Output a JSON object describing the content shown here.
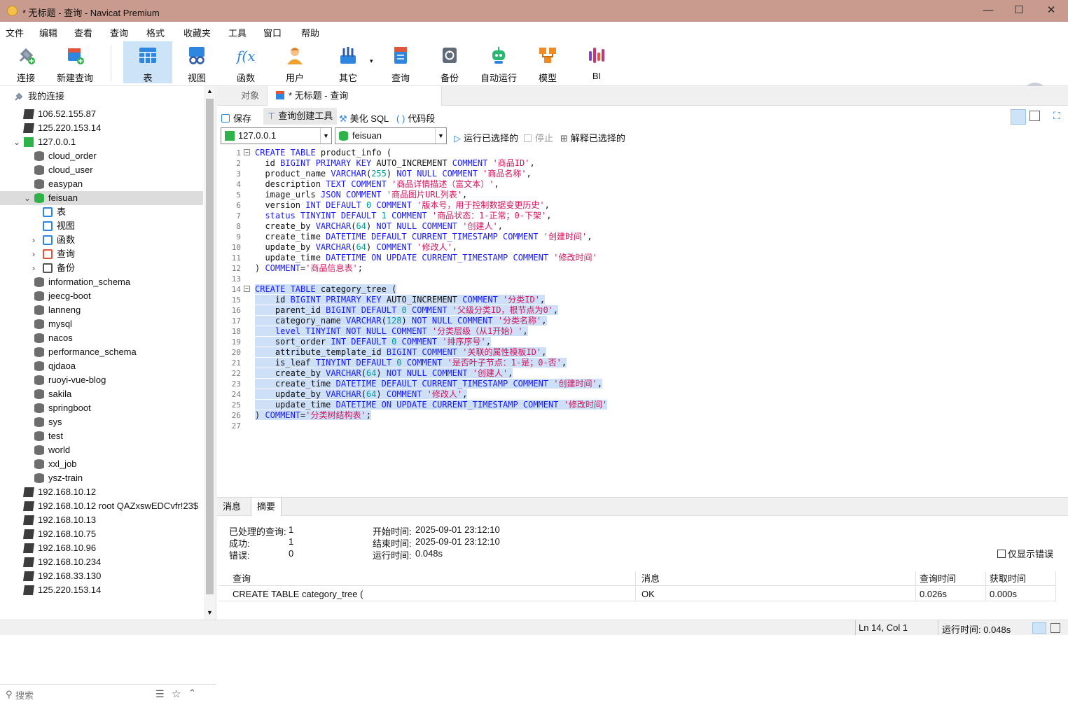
{
  "window": {
    "title": "* 无标题 - 查询 - Navicat Premium",
    "min": "—",
    "max": "☐",
    "close": "✕"
  },
  "menu": [
    "文件",
    "编辑",
    "查看",
    "查询",
    "格式",
    "收藏夹",
    "工具",
    "窗口",
    "帮助"
  ],
  "toolbar": [
    {
      "label": "连接",
      "icon": "plug-icon",
      "color": "#7a8a9a"
    },
    {
      "label": "新建查询",
      "icon": "new-query-icon",
      "color": "#e0563b"
    },
    {
      "label": "表",
      "icon": "table-icon",
      "color": "#2e86de"
    },
    {
      "label": "视图",
      "icon": "view-icon",
      "color": "#2e86de"
    },
    {
      "label": "函数",
      "icon": "function-icon",
      "color": "#2e86de"
    },
    {
      "label": "用户",
      "icon": "user-icon",
      "color": "#f0a030"
    },
    {
      "label": "其它",
      "icon": "tools-icon",
      "color": "#2e86de"
    },
    {
      "label": "查询",
      "icon": "query-icon",
      "color": "#e0563b"
    },
    {
      "label": "备份",
      "icon": "backup-icon",
      "color": "#666666"
    },
    {
      "label": "自动运行",
      "icon": "robot-icon",
      "color": "#2bb673"
    },
    {
      "label": "模型",
      "icon": "model-icon",
      "color": "#f08a24"
    },
    {
      "label": "BI",
      "icon": "bi-icon",
      "color": "#c0397a"
    }
  ],
  "sidebar": {
    "header": "我的连接",
    "items": [
      {
        "label": "106.52.155.87",
        "type": "conn",
        "indent": 0
      },
      {
        "label": "125.220.153.14",
        "type": "conn",
        "indent": 0
      },
      {
        "label": "127.0.0.1",
        "type": "conng",
        "indent": 0,
        "arrow": "⌄"
      },
      {
        "label": "cloud_order",
        "type": "db",
        "indent": 1
      },
      {
        "label": "cloud_user",
        "type": "db",
        "indent": 1
      },
      {
        "label": "easypan",
        "type": "db",
        "indent": 1
      },
      {
        "label": "feisuan",
        "type": "dbg",
        "indent": 1,
        "arrow": "⌄"
      },
      {
        "label": "表",
        "type": "obj",
        "indent": 2
      },
      {
        "label": "视图",
        "type": "obj",
        "indent": 2
      },
      {
        "label": "函数",
        "type": "obj",
        "indent": 2,
        "arrow": "›"
      },
      {
        "label": "查询",
        "type": "obj",
        "indent": 2,
        "arrow": "›"
      },
      {
        "label": "备份",
        "type": "obj",
        "indent": 2,
        "arrow": "›"
      },
      {
        "label": "information_schema",
        "type": "db",
        "indent": 1
      },
      {
        "label": "jeecg-boot",
        "type": "db",
        "indent": 1
      },
      {
        "label": "lanneng",
        "type": "db",
        "indent": 1
      },
      {
        "label": "mysql",
        "type": "db",
        "indent": 1
      },
      {
        "label": "nacos",
        "type": "db",
        "indent": 1
      },
      {
        "label": "performance_schema",
        "type": "db",
        "indent": 1
      },
      {
        "label": "qjdaoa",
        "type": "db",
        "indent": 1
      },
      {
        "label": "ruoyi-vue-blog",
        "type": "db",
        "indent": 1
      },
      {
        "label": "sakila",
        "type": "db",
        "indent": 1
      },
      {
        "label": "springboot",
        "type": "db",
        "indent": 1
      },
      {
        "label": "sys",
        "type": "db",
        "indent": 1
      },
      {
        "label": "test",
        "type": "db",
        "indent": 1
      },
      {
        "label": "world",
        "type": "db",
        "indent": 1
      },
      {
        "label": "xxl_job",
        "type": "db",
        "indent": 1
      },
      {
        "label": "ysz-train",
        "type": "db",
        "indent": 1
      },
      {
        "label": "192.168.10.12",
        "type": "conn",
        "indent": 0
      },
      {
        "label": "192.168.10.12 root QAZxswEDCvfr!23$",
        "type": "conn",
        "indent": 0
      },
      {
        "label": "192.168.10.13",
        "type": "conn",
        "indent": 0
      },
      {
        "label": "192.168.10.75",
        "type": "conn",
        "indent": 0
      },
      {
        "label": "192.168.10.96",
        "type": "conn",
        "indent": 0
      },
      {
        "label": "192.168.10.234",
        "type": "conn",
        "indent": 0
      },
      {
        "label": "192.168.33.130",
        "type": "conn",
        "indent": 0
      },
      {
        "label": "125.220.153.14",
        "type": "conn",
        "indent": 0
      }
    ],
    "search_placeholder": "搜索"
  },
  "tabs": [
    {
      "label": "对象"
    },
    {
      "label": "* 无标题 - 查询"
    }
  ],
  "query_tools": {
    "save": "保存",
    "builder": "查询创建工具",
    "beautify": "美化 SQL",
    "snippet": "代码段"
  },
  "selectors": {
    "connection": "127.0.0.1",
    "database": "feisuan",
    "run": "运行已选择的",
    "stop": "停止",
    "explain": "解释已选择的"
  },
  "code": [
    [
      [
        "k",
        "CREATE TABLE"
      ],
      [
        "t",
        " product_info ("
      ]
    ],
    [
      [
        "t",
        "  id "
      ],
      [
        "k",
        "BIGINT PRIMARY KEY"
      ],
      [
        "t",
        " AUTO_INCREMENT "
      ],
      [
        "k",
        "COMMENT"
      ],
      [
        "s",
        " '商品ID'"
      ],
      [
        "t",
        ","
      ]
    ],
    [
      [
        "t",
        "  product_name "
      ],
      [
        "k",
        "VARCHAR"
      ],
      [
        "t",
        "("
      ],
      [
        "n",
        "255"
      ],
      [
        "t",
        ") "
      ],
      [
        "k",
        "NOT NULL COMMENT"
      ],
      [
        "s",
        " '商品名称'"
      ],
      [
        "t",
        ","
      ]
    ],
    [
      [
        "t",
        "  description "
      ],
      [
        "k",
        "TEXT COMMENT"
      ],
      [
        "s",
        " '商品详情描述（富文本）'"
      ],
      [
        "t",
        ","
      ]
    ],
    [
      [
        "t",
        "  image_urls "
      ],
      [
        "k",
        "JSON COMMENT"
      ],
      [
        "s",
        " '商品图片URL列表'"
      ],
      [
        "t",
        ","
      ]
    ],
    [
      [
        "t",
        "  version "
      ],
      [
        "k",
        "INT DEFAULT"
      ],
      [
        "n",
        " 0"
      ],
      [
        "k",
        " COMMENT"
      ],
      [
        "s",
        " '版本号，用于控制数据变更历史'"
      ],
      [
        "t",
        ","
      ]
    ],
    [
      [
        "k",
        "  status TINYINT DEFAULT"
      ],
      [
        "n",
        " 1"
      ],
      [
        "k",
        " COMMENT"
      ],
      [
        "s",
        " '商品状态：1-正常；0-下架'"
      ],
      [
        "t",
        ","
      ]
    ],
    [
      [
        "t",
        "  create_by "
      ],
      [
        "k",
        "VARCHAR"
      ],
      [
        "t",
        "("
      ],
      [
        "n",
        "64"
      ],
      [
        "t",
        ") "
      ],
      [
        "k",
        "NOT NULL COMMENT"
      ],
      [
        "s",
        " '创建人'"
      ],
      [
        "t",
        ","
      ]
    ],
    [
      [
        "t",
        "  create_time "
      ],
      [
        "k",
        "DATETIME DEFAULT CURRENT_TIMESTAMP COMMENT"
      ],
      [
        "s",
        " '创建时间'"
      ],
      [
        "t",
        ","
      ]
    ],
    [
      [
        "t",
        "  update_by "
      ],
      [
        "k",
        "VARCHAR"
      ],
      [
        "t",
        "("
      ],
      [
        "n",
        "64"
      ],
      [
        "t",
        ") "
      ],
      [
        "k",
        "COMMENT"
      ],
      [
        "s",
        " '修改人'"
      ],
      [
        "t",
        ","
      ]
    ],
    [
      [
        "t",
        "  update_time "
      ],
      [
        "k",
        "DATETIME ON UPDATE CURRENT_TIMESTAMP COMMENT"
      ],
      [
        "s",
        " '修改时间'"
      ]
    ],
    [
      [
        "t",
        ") "
      ],
      [
        "k",
        "COMMENT"
      ],
      [
        "t",
        "="
      ],
      [
        "s",
        "'商品信息表'"
      ],
      [
        "t",
        ";"
      ]
    ],
    [],
    [
      [
        "k",
        "CREATE TABLE"
      ],
      [
        "t",
        " category_tree ("
      ]
    ],
    [
      [
        "t",
        "    id "
      ],
      [
        "k",
        "BIGINT PRIMARY KEY"
      ],
      [
        "t",
        " AUTO_INCREMENT "
      ],
      [
        "k",
        "COMMENT"
      ],
      [
        "s",
        " '分类ID'"
      ],
      [
        "t",
        ","
      ]
    ],
    [
      [
        "t",
        "    parent_id "
      ],
      [
        "k",
        "BIGINT DEFAULT"
      ],
      [
        "n",
        " 0"
      ],
      [
        "k",
        " COMMENT"
      ],
      [
        "s",
        " '父级分类ID，根节点为0'"
      ],
      [
        "t",
        ","
      ]
    ],
    [
      [
        "t",
        "    category_name "
      ],
      [
        "k",
        "VARCHAR"
      ],
      [
        "t",
        "("
      ],
      [
        "n",
        "128"
      ],
      [
        "t",
        ") "
      ],
      [
        "k",
        "NOT NULL COMMENT"
      ],
      [
        "s",
        " '分类名称'"
      ],
      [
        "t",
        ","
      ]
    ],
    [
      [
        "k",
        "    level TINYINT NOT NULL COMMENT"
      ],
      [
        "s",
        " '分类层级（从1开始）'"
      ],
      [
        "t",
        ","
      ]
    ],
    [
      [
        "t",
        "    sort_order "
      ],
      [
        "k",
        "INT DEFAULT"
      ],
      [
        "n",
        " 0"
      ],
      [
        "k",
        " COMMENT"
      ],
      [
        "s",
        " '排序序号'"
      ],
      [
        "t",
        ","
      ]
    ],
    [
      [
        "t",
        "    attribute_template_id "
      ],
      [
        "k",
        "BIGINT COMMENT"
      ],
      [
        "s",
        " '关联的属性模板ID'"
      ],
      [
        "t",
        ","
      ]
    ],
    [
      [
        "t",
        "    is_leaf "
      ],
      [
        "k",
        "TINYINT DEFAULT"
      ],
      [
        "n",
        " 0"
      ],
      [
        "k",
        " COMMENT"
      ],
      [
        "s",
        " '是否叶子节点：1-是；0-否'"
      ],
      [
        "t",
        ","
      ]
    ],
    [
      [
        "t",
        "    create_by "
      ],
      [
        "k",
        "VARCHAR"
      ],
      [
        "t",
        "("
      ],
      [
        "n",
        "64"
      ],
      [
        "t",
        ") "
      ],
      [
        "k",
        "NOT NULL COMMENT"
      ],
      [
        "s",
        " '创建人'"
      ],
      [
        "t",
        ","
      ]
    ],
    [
      [
        "t",
        "    create_time "
      ],
      [
        "k",
        "DATETIME DEFAULT CURRENT_TIMESTAMP COMMENT"
      ],
      [
        "s",
        " '创建时间'"
      ],
      [
        "t",
        ","
      ]
    ],
    [
      [
        "t",
        "    update_by "
      ],
      [
        "k",
        "VARCHAR"
      ],
      [
        "t",
        "("
      ],
      [
        "n",
        "64"
      ],
      [
        "t",
        ") "
      ],
      [
        "k",
        "COMMENT"
      ],
      [
        "s",
        " '修改人'"
      ],
      [
        "t",
        ","
      ]
    ],
    [
      [
        "t",
        "    update_time "
      ],
      [
        "k",
        "DATETIME ON UPDATE CURRENT_TIMESTAMP COMMENT"
      ],
      [
        "s",
        " '修改时间'"
      ]
    ],
    [
      [
        "t",
        ") "
      ],
      [
        "k",
        "COMMENT"
      ],
      [
        "t",
        "="
      ],
      [
        "s",
        "'分类树结构表'"
      ],
      [
        "t",
        ";"
      ]
    ],
    []
  ],
  "code_selected_from": 14,
  "results": {
    "tabs": [
      "消息",
      "摘要"
    ],
    "processed_label": "已处理的查询:",
    "processed": "1",
    "success_label": "成功:",
    "success": "1",
    "error_label": "错误:",
    "error": "0",
    "start_label": "开始时间:",
    "start": "2025-09-01 23:12:10",
    "end_label": "结束时间:",
    "end": "2025-09-01 23:12:10",
    "run_label": "运行时间:",
    "run": "0.048s",
    "only_errors": "仅显示错误",
    "grid_headers": [
      "查询",
      "消息",
      "查询时间",
      "获取时间"
    ],
    "grid_row": [
      "CREATE TABLE category_tree (",
      "OK",
      "0.026s",
      "0.000s"
    ]
  },
  "status": {
    "position": "Ln 14, Col 1",
    "runtime": "运行时间: 0.048s"
  }
}
